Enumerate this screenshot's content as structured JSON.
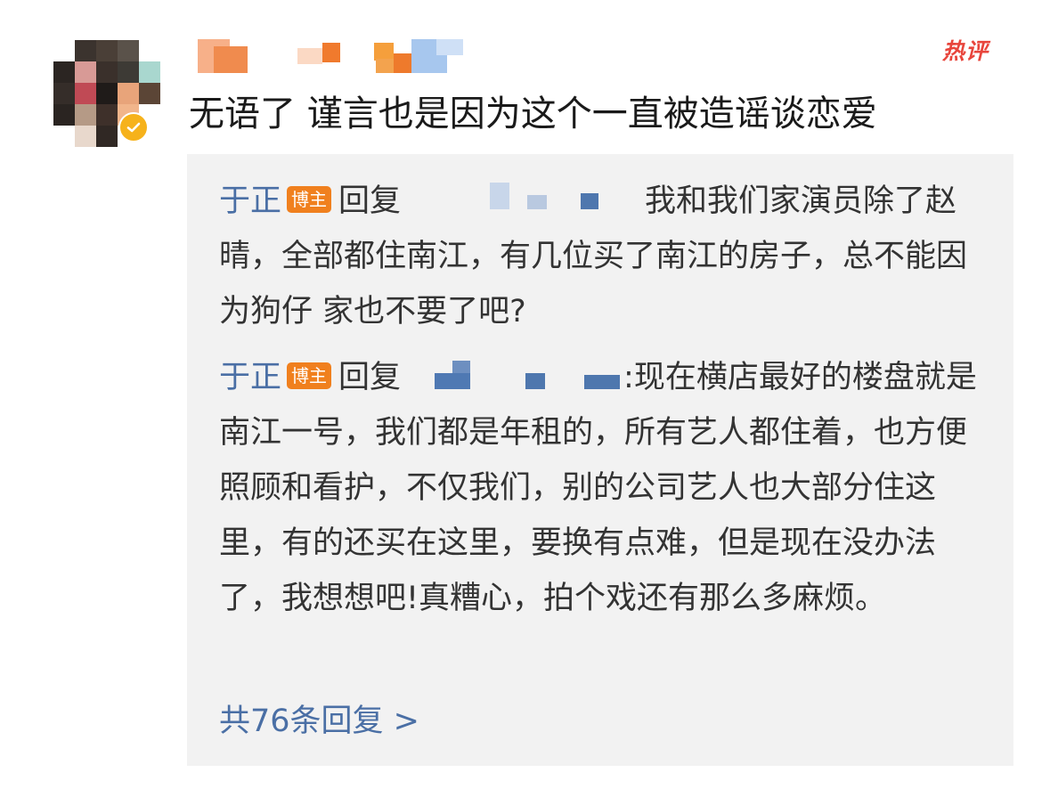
{
  "hot_tag": {
    "label": "热评",
    "color": "#e8453c"
  },
  "comment": {
    "text": "无语了 谨言也是因为这个一直被造谣谈恋爱",
    "avatar_icon": "verified-check-icon"
  },
  "replies": [
    {
      "author": "于正",
      "badge": "博主",
      "verb": "回复",
      "text": "我和我们家演员除了赵晴，全部都住南江，有几位买了南江的房子，总不能因为狗仔  家也不要了吧?"
    },
    {
      "author": "于正",
      "badge": "博主",
      "verb": "回复",
      "text": ":现在横店最好的楼盘就是南江一号，我们都是年租的，所有艺人都住着，也方便照顾和看护，不仅我们，别的公司艺人也大部分住这里，有的还买在这里，要换有点难，但是现在没办法了，我想想吧!真糟心，拍个戏还有那么多麻烦。"
    }
  ],
  "more_replies": "共76条回复 >",
  "colors": {
    "link_blue": "#4a6fa5",
    "badge_orange": "#f0801e",
    "reply_bg": "#f2f2f2"
  }
}
